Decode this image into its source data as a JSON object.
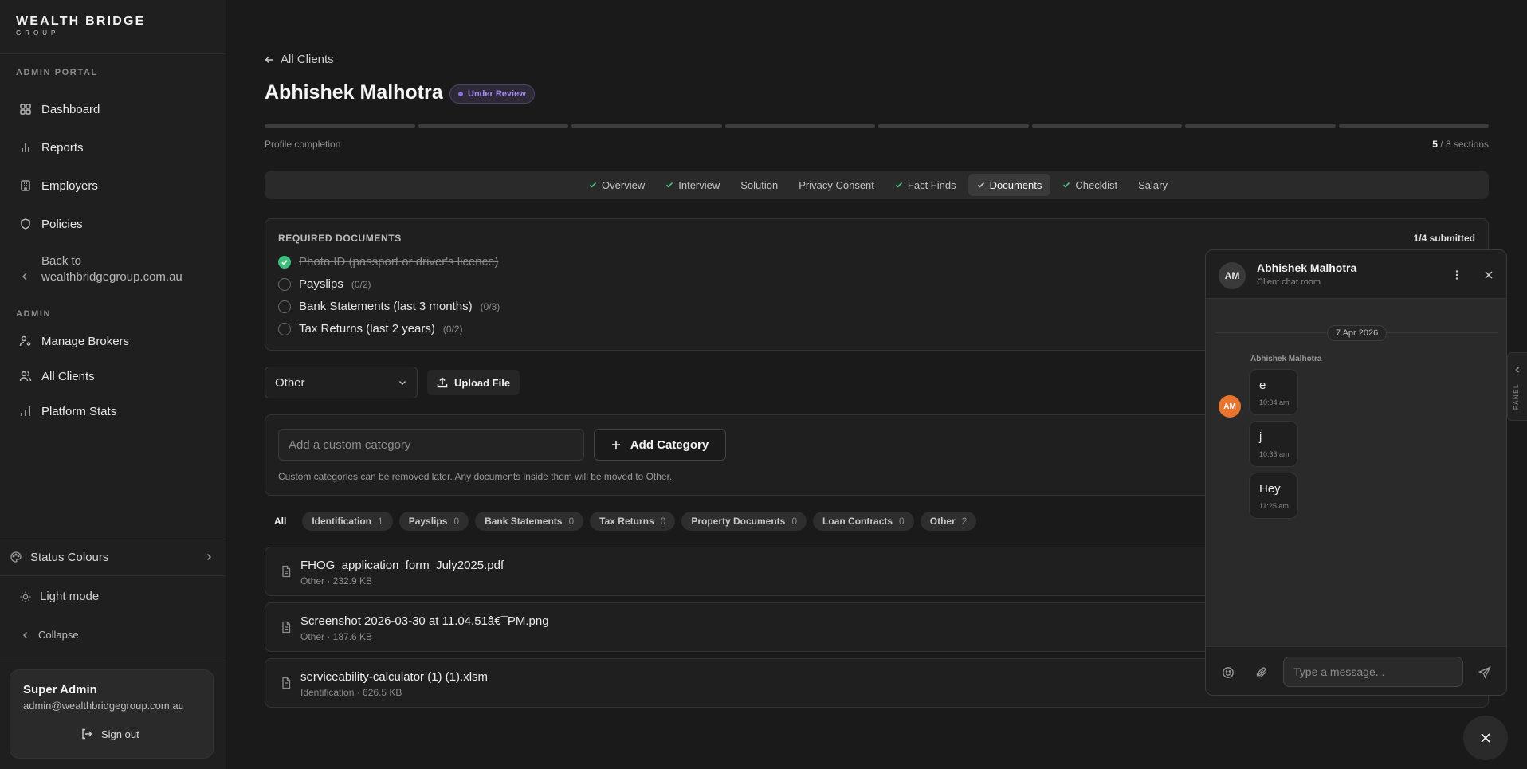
{
  "brand": {
    "name": "WEALTH BRIDGE",
    "sub": "GROUP"
  },
  "sidebar": {
    "portal_label": "ADMIN PORTAL",
    "items": [
      {
        "label": "Dashboard",
        "icon": "grid-icon"
      },
      {
        "label": "Reports",
        "icon": "bar-chart-icon"
      },
      {
        "label": "Employers",
        "icon": "building-icon"
      },
      {
        "label": "Policies",
        "icon": "shield-icon"
      }
    ],
    "back_label": "Back to wealthbridgegroup.com.au",
    "admin_label": "ADMIN",
    "admin_items": [
      {
        "label": "Manage Brokers",
        "icon": "user-cog-icon"
      },
      {
        "label": "All Clients",
        "icon": "users-icon"
      },
      {
        "label": "Platform Stats",
        "icon": "stats-icon"
      }
    ],
    "status_colours": "Status Colours",
    "light_mode": "Light mode",
    "collapse": "Collapse",
    "user": {
      "name": "Super Admin",
      "email": "admin@wealthbridgegroup.com.au",
      "sign_out": "Sign out"
    }
  },
  "main": {
    "back_link": "All Clients",
    "title": "Abhishek Malhotra",
    "status_badge": "Under Review",
    "profile_completion_label": "Profile completion",
    "sections_done": "5",
    "sections_total": "/ 8 sections",
    "tabs": [
      {
        "label": "Overview",
        "checked": true
      },
      {
        "label": "Interview",
        "checked": true
      },
      {
        "label": "Solution",
        "checked": false
      },
      {
        "label": "Privacy Consent",
        "checked": false
      },
      {
        "label": "Fact Finds",
        "checked": true
      },
      {
        "label": "Documents",
        "checked": true,
        "active": true
      },
      {
        "label": "Checklist",
        "checked": true
      },
      {
        "label": "Salary",
        "checked": false
      }
    ],
    "required": {
      "title": "REQUIRED DOCUMENTS",
      "count": "1/4 submitted",
      "items": [
        {
          "label": "Photo ID (passport or driver's licence)",
          "count": "",
          "done": true
        },
        {
          "label": "Payslips",
          "count": "(0/2)",
          "done": false
        },
        {
          "label": "Bank Statements (last 3 months)",
          "count": "(0/3)",
          "done": false
        },
        {
          "label": "Tax Returns (last 2 years)",
          "count": "(0/2)",
          "done": false
        }
      ]
    },
    "category_select": "Other",
    "upload_button": "Upload File",
    "custom_category": {
      "placeholder": "Add a custom category",
      "button": "Add Category",
      "hint": "Custom categories can be removed later. Any documents inside them will be moved to Other."
    },
    "filters": [
      {
        "label": "All",
        "count": "",
        "active": true
      },
      {
        "label": "Identification",
        "count": "1"
      },
      {
        "label": "Payslips",
        "count": "0"
      },
      {
        "label": "Bank Statements",
        "count": "0"
      },
      {
        "label": "Tax Returns",
        "count": "0"
      },
      {
        "label": "Property Documents",
        "count": "0"
      },
      {
        "label": "Loan Contracts",
        "count": "0"
      },
      {
        "label": "Other",
        "count": "2"
      }
    ],
    "files": [
      {
        "name": "FHOG_application_form_July2025.pdf",
        "meta": "Other · 232.9 KB"
      },
      {
        "name": "Screenshot 2026-03-30 at 11.04.51â€¯PM.png",
        "meta": "Other · 187.6 KB"
      },
      {
        "name": "serviceability-calculator (1) (1).xlsm",
        "meta": "Identification · 626.5 KB"
      }
    ]
  },
  "chat": {
    "avatar": "AM",
    "name": "Abhishek Malhotra",
    "subtitle": "Client chat room",
    "date": "7 Apr 2026",
    "sender": "Abhishek Malhotra",
    "sender_avatar": "AM",
    "messages": [
      {
        "text": "e",
        "time": "10:04 am"
      },
      {
        "text": "j",
        "time": "10:33 am"
      },
      {
        "text": "Hey",
        "time": "11:25 am"
      }
    ],
    "input_placeholder": "Type a message..."
  },
  "panel_tab_label": "PANEL",
  "colors": {
    "accent_purple": "#8d6fe0",
    "success_green": "#3dbe7c",
    "avatar_orange": "#e8742d"
  }
}
